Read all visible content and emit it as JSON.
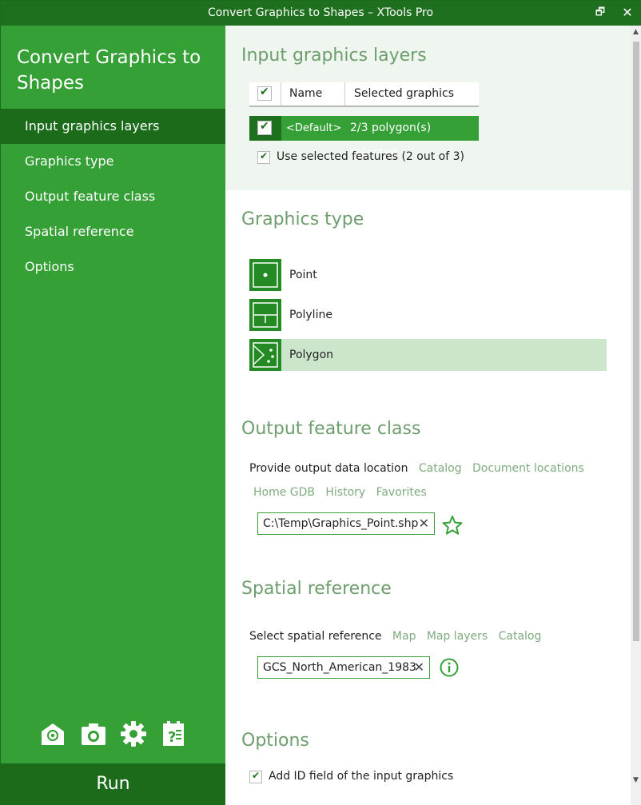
{
  "window": {
    "title": "Convert Graphics to Shapes – XTools Pro",
    "restore_glyph": "🗗",
    "close_glyph": "✕"
  },
  "sidebar": {
    "heading": "Convert Graphics to Shapes",
    "items": [
      {
        "label": "Input graphics layers",
        "active": true
      },
      {
        "label": "Graphics type",
        "active": false
      },
      {
        "label": "Output feature class",
        "active": false
      },
      {
        "label": "Spatial reference",
        "active": false
      },
      {
        "label": "Options",
        "active": false
      }
    ],
    "footer_icons": [
      "email-icon",
      "camera-icon",
      "gear-icon",
      "help-icon"
    ],
    "run_label": "Run"
  },
  "input_layers": {
    "title": "Input graphics layers",
    "columns": {
      "name": "Name",
      "selected": "Selected graphics"
    },
    "rows": [
      {
        "checked": true,
        "name": "<Default>",
        "selected": "2/3 polygon(s) selected"
      }
    ],
    "use_selected": {
      "checked": true,
      "label": "Use selected features (2 out of 3)"
    }
  },
  "graphics_type": {
    "title": "Graphics type",
    "options": [
      {
        "label": "Point",
        "icon": "point-icon",
        "selected": false
      },
      {
        "label": "Polyline",
        "icon": "polyline-icon",
        "selected": false
      },
      {
        "label": "Polygon",
        "icon": "polygon-icon",
        "selected": true
      }
    ]
  },
  "output": {
    "title": "Output feature class",
    "provide_label": "Provide output data location",
    "links_row1": [
      "Catalog",
      "Document locations"
    ],
    "links_row2": [
      "Home GDB",
      "History",
      "Favorites"
    ],
    "path_value": "C:\\Temp\\Graphics_Point.shp"
  },
  "spatial": {
    "title": "Spatial reference",
    "select_label": "Select spatial reference",
    "links": [
      "Map",
      "Map layers",
      "Catalog"
    ],
    "value": "GCS_North_American_1983"
  },
  "options": {
    "title": "Options",
    "add_id": {
      "checked": true,
      "label": "Add ID field of the input graphics"
    }
  },
  "colors": {
    "sidebar": "#35a035",
    "dark_green": "#1b6b1b",
    "link": "#7fab7f",
    "selected_bg": "#cbe6cb"
  }
}
